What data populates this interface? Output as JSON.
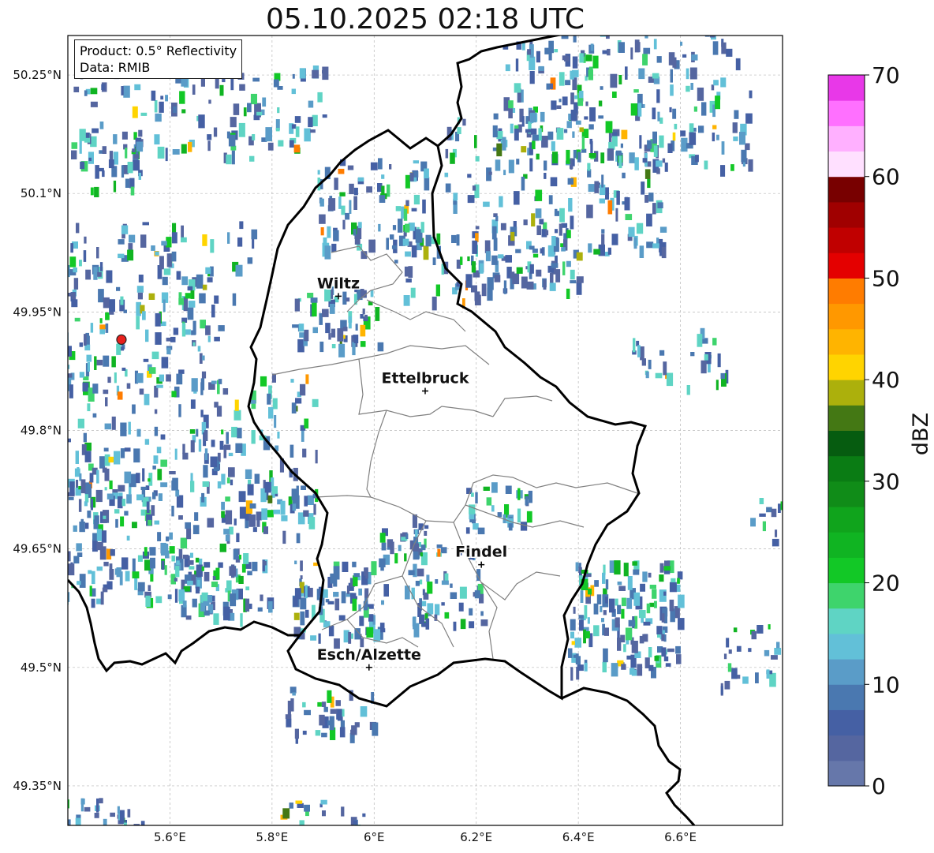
{
  "title": "05.10.2025 02:18 UTC",
  "annotation": {
    "product": "Product: 0.5° Reflectivity",
    "data": "Data: RMIB"
  },
  "map": {
    "extent": {
      "lon": [
        5.4,
        6.8
      ],
      "lat": [
        49.3,
        50.3
      ]
    },
    "lat_ticks": [
      {
        "value": 50.25,
        "label": "50.25°N"
      },
      {
        "value": 50.1,
        "label": "50.1°N"
      },
      {
        "value": 49.95,
        "label": "49.95°N"
      },
      {
        "value": 49.8,
        "label": "49.8°N"
      },
      {
        "value": 49.65,
        "label": "49.65°N"
      },
      {
        "value": 49.5,
        "label": "49.5°N"
      },
      {
        "value": 49.35,
        "label": "49.35°N"
      }
    ],
    "lon_ticks": [
      {
        "value": 5.6,
        "label": "5.6°E"
      },
      {
        "value": 5.8,
        "label": "5.8°E"
      },
      {
        "value": 6.0,
        "label": "6°E"
      },
      {
        "value": 6.2,
        "label": "6.2°E"
      },
      {
        "value": 6.4,
        "label": "6.4°E"
      },
      {
        "value": 6.6,
        "label": "6.6°E"
      }
    ],
    "grid": true,
    "cities": [
      {
        "name": "Wiltz",
        "lon": 5.93,
        "lat": 49.97
      },
      {
        "name": "Ettelbruck",
        "lon": 6.1,
        "lat": 49.85
      },
      {
        "name": "Findel",
        "lon": 6.21,
        "lat": 49.63
      },
      {
        "name": "Esch/Alzette",
        "lon": 5.99,
        "lat": 49.5
      }
    ],
    "radar_site": {
      "lon": 5.505,
      "lat": 49.915,
      "color": "#e8201c"
    },
    "colorbar": {
      "label": "dBZ",
      "ticks": [
        0,
        10,
        20,
        30,
        40,
        50,
        60,
        70
      ],
      "colors": [
        "#6677aa",
        "#5566a0",
        "#4560a4",
        "#4a78b0",
        "#5a9cc8",
        "#62c0d8",
        "#5fd4c4",
        "#3ed46c",
        "#12c826",
        "#10b422",
        "#10a41c",
        "#108c18",
        "#0a7c14",
        "#065c10",
        "#447814",
        "#acb00c",
        "#ffd400",
        "#ffb400",
        "#ff9800",
        "#ff7c00",
        "#e40000",
        "#c00000",
        "#a00000",
        "#780000",
        "#ffe0ff",
        "#ffb0ff",
        "#ff70ff",
        "#e838e8"
      ]
    }
  }
}
